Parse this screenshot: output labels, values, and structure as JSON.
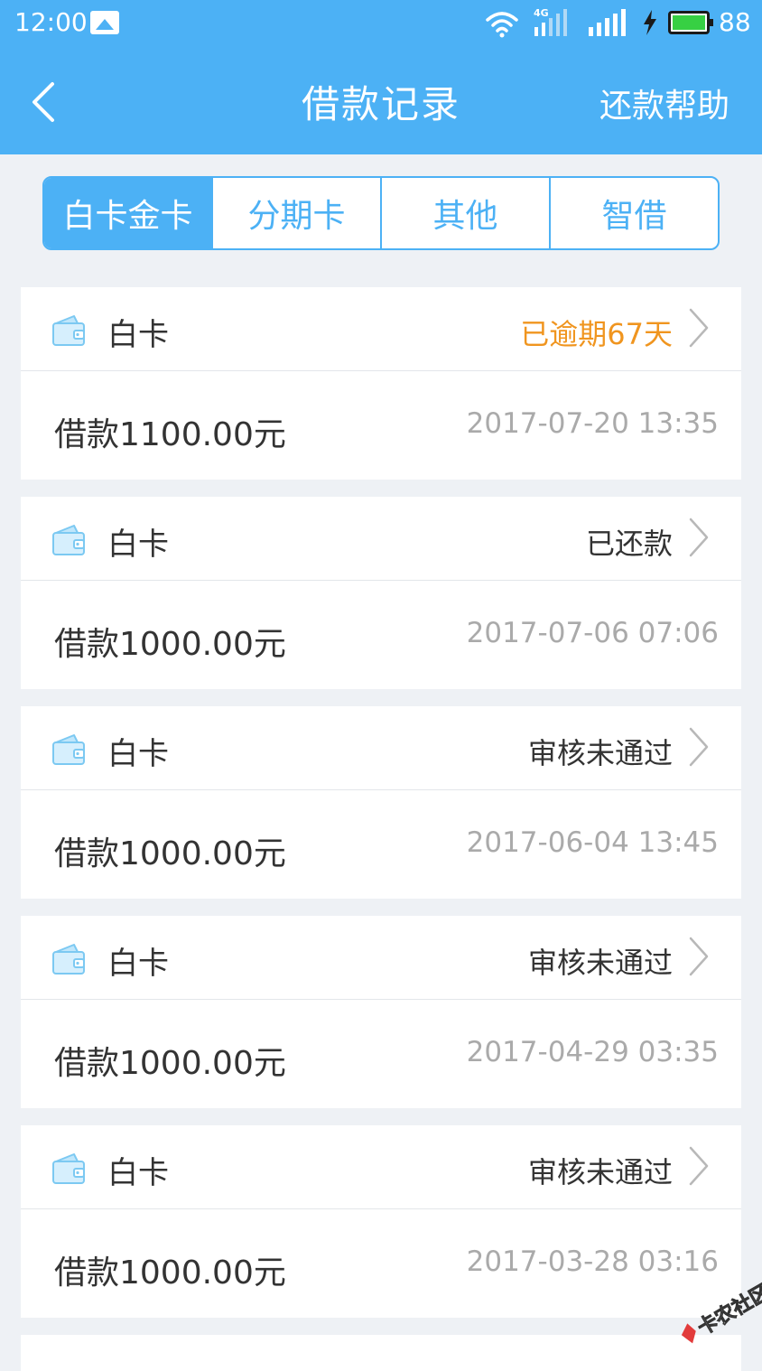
{
  "status_bar": {
    "time": "12:00",
    "network": "4G",
    "battery": "88"
  },
  "header": {
    "title": "借款记录",
    "help": "还款帮助"
  },
  "tabs": [
    {
      "label": "白卡金卡",
      "active": true
    },
    {
      "label": "分期卡",
      "active": false
    },
    {
      "label": "其他",
      "active": false
    },
    {
      "label": "智借",
      "active": false
    }
  ],
  "records": [
    {
      "type": "白卡",
      "status": "已逾期67天",
      "status_kind": "overdue",
      "amount": "借款1100.00元",
      "time": "2017-07-20 13:35"
    },
    {
      "type": "白卡",
      "status": "已还款",
      "status_kind": "normal",
      "amount": "借款1000.00元",
      "time": "2017-07-06 07:06"
    },
    {
      "type": "白卡",
      "status": "审核未通过",
      "status_kind": "normal",
      "amount": "借款1000.00元",
      "time": "2017-06-04 13:45"
    },
    {
      "type": "白卡",
      "status": "审核未通过",
      "status_kind": "normal",
      "amount": "借款1000.00元",
      "time": "2017-04-29 03:35"
    },
    {
      "type": "白卡",
      "status": "审核未通过",
      "status_kind": "normal",
      "amount": "借款1000.00元",
      "time": "2017-03-28 03:16"
    }
  ],
  "watermark": "卡农社区",
  "colors": {
    "primary": "#4cb1f5",
    "overdue": "#f0951f",
    "text": "#333333",
    "muted": "#aaaaaa",
    "background": "#eef1f5"
  }
}
